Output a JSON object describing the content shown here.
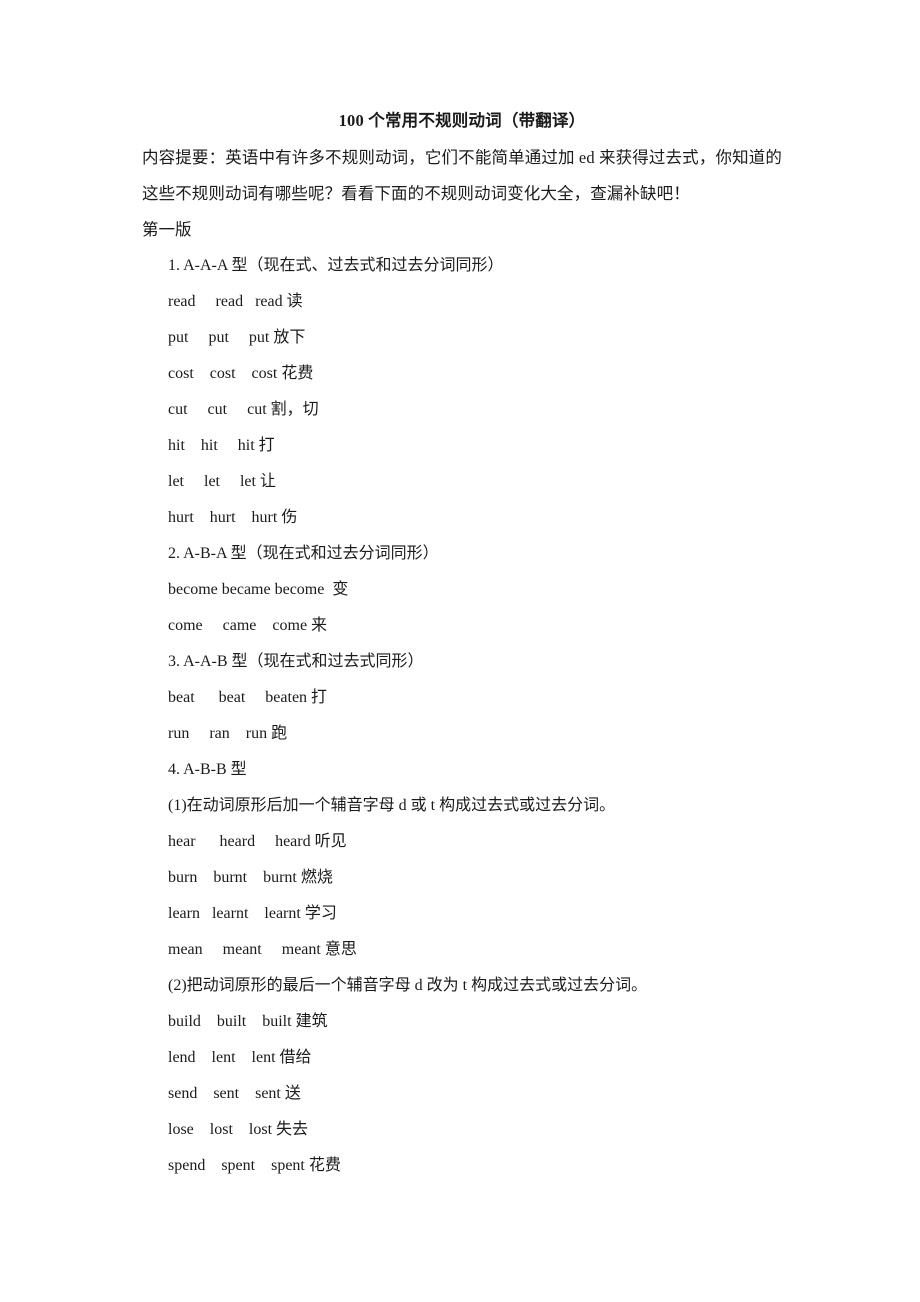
{
  "document": {
    "title": "100 个常用不规则动词（带翻译）",
    "intro": "内容提要：英语中有许多不规则动词，它们不能简单通过加 ed 来获得过去式，你知道的这些不规则动词有哪些呢？看看下面的不规则动词变化大全，查漏补缺吧！",
    "edition": "第一版",
    "sections": [
      {
        "heading": "1. A-A-A 型（现在式、过去式和过去分词同形）",
        "notes": [],
        "rows": [
          {
            "text": "read     read   read 读",
            "base": "read",
            "past": "read",
            "participle": "read",
            "meaning": "读"
          },
          {
            "text": "put     put     put 放下",
            "base": "put",
            "past": "put",
            "participle": "put",
            "meaning": "放下"
          },
          {
            "text": "cost    cost    cost 花费",
            "base": "cost",
            "past": "cost",
            "participle": "cost",
            "meaning": "花费"
          },
          {
            "text": "cut     cut     cut 割，切",
            "base": "cut",
            "past": "cut",
            "participle": "cut",
            "meaning": "割，切"
          },
          {
            "text": "hit    hit     hit 打",
            "base": "hit",
            "past": "hit",
            "participle": "hit",
            "meaning": "打"
          },
          {
            "text": "let     let     let 让",
            "base": "let",
            "past": "let",
            "participle": "let",
            "meaning": "让"
          },
          {
            "text": "hurt    hurt    hurt 伤",
            "base": "hurt",
            "past": "hurt",
            "participle": "hurt",
            "meaning": "伤"
          }
        ]
      },
      {
        "heading": "2. A-B-A 型（现在式和过去分词同形）",
        "notes": [],
        "rows": [
          {
            "text": "become became become  变",
            "base": "become",
            "past": "became",
            "participle": "become",
            "meaning": "变"
          },
          {
            "text": "come     came    come 来",
            "base": "come",
            "past": "came",
            "participle": "come",
            "meaning": "来"
          }
        ]
      },
      {
        "heading": "3. A-A-B 型（现在式和过去式同形）",
        "notes": [],
        "rows": [
          {
            "text": "beat      beat     beaten 打",
            "base": "beat",
            "past": "beat",
            "participle": "beaten",
            "meaning": "打"
          },
          {
            "text": "run     ran    run 跑",
            "base": "run",
            "past": "ran",
            "participle": "run",
            "meaning": "跑"
          }
        ]
      },
      {
        "heading": "4. A-B-B 型",
        "notes": [
          "(1)在动词原形后加一个辅音字母 d 或 t 构成过去式或过去分词。"
        ],
        "rows": [
          {
            "text": "hear      heard     heard 听见",
            "base": "hear",
            "past": "heard",
            "participle": "heard",
            "meaning": "听见"
          },
          {
            "text": "burn    burnt    burnt 燃烧",
            "base": "burn",
            "past": "burnt",
            "participle": "burnt",
            "meaning": "燃烧"
          },
          {
            "text": "learn   learnt    learnt 学习",
            "base": "learn",
            "past": "learnt",
            "participle": "learnt",
            "meaning": "学习"
          },
          {
            "text": "mean     meant     meant 意思",
            "base": "mean",
            "past": "meant",
            "participle": "meant",
            "meaning": "意思"
          }
        ]
      },
      {
        "heading": "",
        "notes": [
          "(2)把动词原形的最后一个辅音字母 d 改为 t 构成过去式或过去分词。"
        ],
        "rows": [
          {
            "text": "build    built    built 建筑",
            "base": "build",
            "past": "built",
            "participle": "built",
            "meaning": "建筑"
          },
          {
            "text": "lend    lent    lent 借给",
            "base": "lend",
            "past": "lent",
            "participle": "lent",
            "meaning": "借给"
          },
          {
            "text": "send    sent    sent 送",
            "base": "send",
            "past": "sent",
            "participle": "sent",
            "meaning": "送"
          },
          {
            "text": "lose    lost    lost 失去",
            "base": "lose",
            "past": "lost",
            "participle": "lost",
            "meaning": "失去"
          },
          {
            "text": "spend    spent    spent 花费",
            "base": "spend",
            "past": "spent",
            "participle": "spent",
            "meaning": "花费"
          }
        ]
      }
    ]
  }
}
